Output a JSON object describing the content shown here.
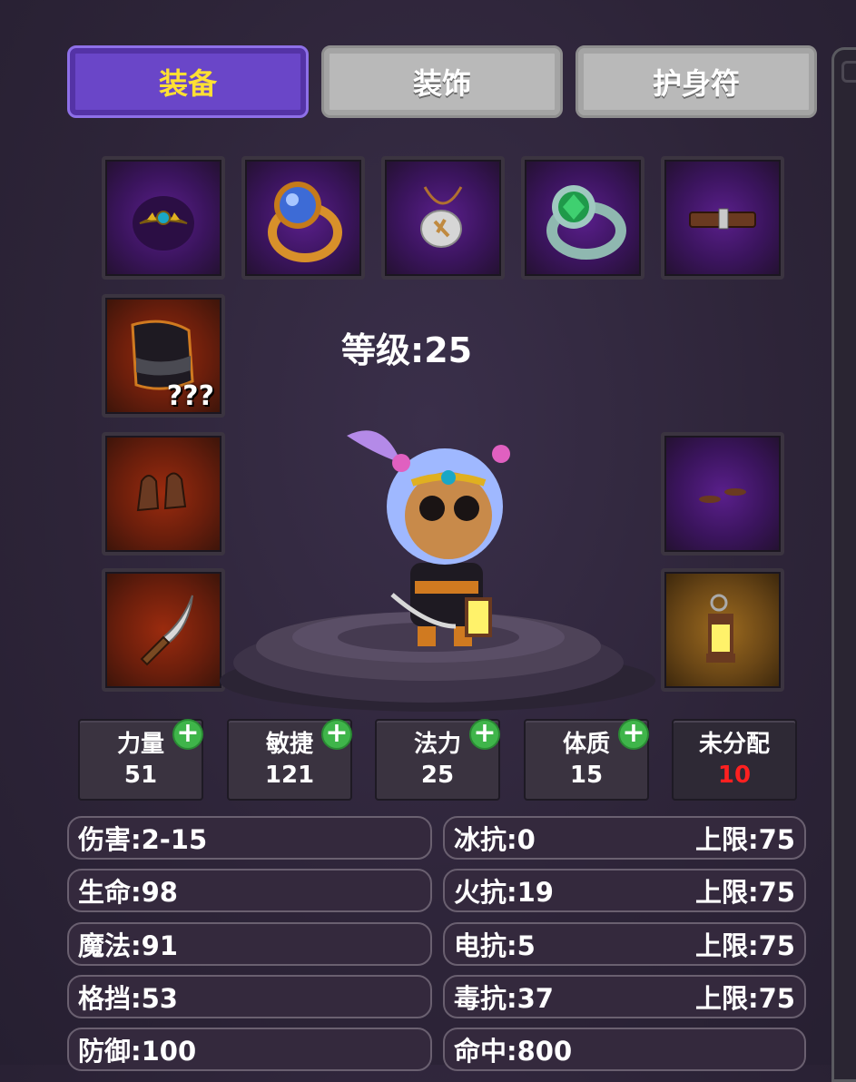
{
  "tabs": [
    {
      "label": "装备",
      "active": true
    },
    {
      "label": "装饰",
      "active": false
    },
    {
      "label": "护身符",
      "active": false
    }
  ],
  "slots": {
    "unknown_label": "???"
  },
  "level": "等级:25",
  "stats": [
    {
      "label": "力量",
      "value": "51"
    },
    {
      "label": "敏捷",
      "value": "121"
    },
    {
      "label": "法力",
      "value": "25"
    },
    {
      "label": "体质",
      "value": "15"
    },
    {
      "label": "未分配",
      "value": "10"
    }
  ],
  "attributes_left": [
    "伤害:2-15",
    "生命:98",
    "魔法:91",
    "格挡:53",
    "防御:100"
  ],
  "attributes_right": [
    {
      "name": "冰抗:0",
      "limit": "上限:75"
    },
    {
      "name": "火抗:19",
      "limit": "上限:75"
    },
    {
      "name": "电抗:5",
      "limit": "上限:75"
    },
    {
      "name": "毒抗:37",
      "limit": "上限:75"
    },
    {
      "name": "命中:800",
      "limit": ""
    }
  ],
  "colors": {
    "active_tab": "#6a46c8",
    "active_tab_text": "#ffe033",
    "inactive_tab": "#b9b9b9",
    "plus_button": "#3fb54a",
    "unassigned_value": "#ff2020"
  }
}
